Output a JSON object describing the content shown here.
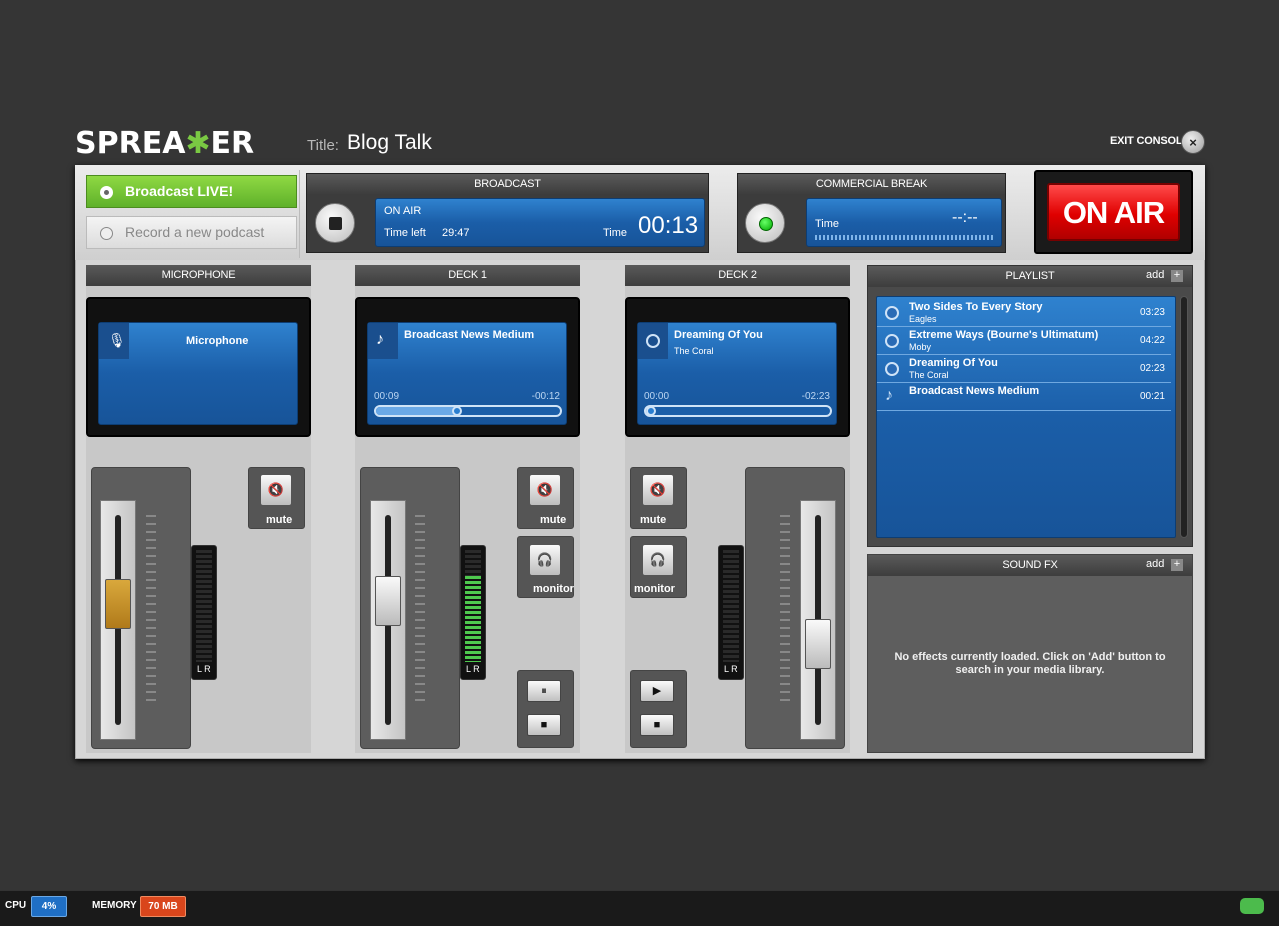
{
  "header": {
    "logo_pre": "SPREA",
    "logo_mic": "✱",
    "logo_post": "ER",
    "title_label": "Title:",
    "title_value": "Blog Talk",
    "exit_label": "EXIT CONSOLE",
    "exit_icon": "close-icon",
    "exit_glyph": "×"
  },
  "mode": {
    "live_label": "Broadcast LIVE!",
    "record_label": "Record a new podcast",
    "selected": "live"
  },
  "broadcast": {
    "title": "BROADCAST",
    "status": "ON AIR",
    "time_left_label": "Time left",
    "time_left": "29:47",
    "time_label": "Time",
    "time": "00:13"
  },
  "commercial": {
    "title": "COMMERCIAL BREAK",
    "time_label": "Time",
    "time": "--:--"
  },
  "onair": {
    "label": "ON AIR",
    "color": "#e00000"
  },
  "microphone": {
    "title": "MICROPHONE",
    "name": "Microphone",
    "mute_label": "mute",
    "meter_label": "L R",
    "level": 0.6
  },
  "deck1": {
    "title": "DECK 1",
    "track": "Broadcast News Medium",
    "elapsed": "00:09",
    "remaining": "-00:12",
    "progress": 0.43,
    "mute_label": "mute",
    "monitor_label": "monitor",
    "meter_label": "L R",
    "level": 0.62,
    "pause_glyph": "⏸",
    "stop_glyph": "■"
  },
  "deck2": {
    "title": "DECK 2",
    "track": "Dreaming Of You",
    "artist": "The Coral",
    "elapsed": "00:00",
    "remaining": "-02:23",
    "progress": 0.0,
    "mute_label": "mute",
    "monitor_label": "monitor",
    "meter_label": "L R",
    "level": 0.35,
    "play_glyph": "▶",
    "stop_glyph": "■"
  },
  "playlist": {
    "title": "PLAYLIST",
    "add_label": "add",
    "items": [
      {
        "title": "Two Sides To Every Story",
        "artist": "Eagles",
        "duration": "03:23",
        "icon": "disc-icon"
      },
      {
        "title": "Extreme Ways (Bourne's Ultimatum)",
        "artist": "Moby",
        "duration": "04:22",
        "icon": "disc-icon"
      },
      {
        "title": "Dreaming Of You",
        "artist": "The Coral",
        "duration": "02:23",
        "icon": "disc-icon"
      },
      {
        "title": "Broadcast News Medium",
        "artist": "",
        "duration": "00:21",
        "icon": "music-note-icon"
      }
    ]
  },
  "soundfx": {
    "title": "SOUND FX",
    "add_label": "add",
    "empty_message": "No effects currently loaded. Click on 'Add' button to search in your media library."
  },
  "status": {
    "cpu_label": "CPU",
    "cpu_value": "4%",
    "memory_label": "MEMORY",
    "memory_value": "70 MB",
    "cpu_color": "#1f6fc5",
    "memory_color": "#d9461c"
  }
}
